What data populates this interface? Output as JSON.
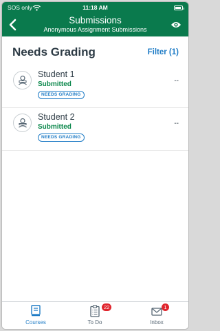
{
  "status_bar": {
    "carrier": "SOS only",
    "time": "11:18 AM"
  },
  "nav": {
    "title": "Submissions",
    "subtitle": "Anonymous Assignment Submissions"
  },
  "header": {
    "title": "Needs Grading",
    "filter_label": "Filter (1)"
  },
  "students": [
    {
      "name": "Student 1",
      "status": "Submitted",
      "badge": "NEEDS GRADING",
      "grade": "--"
    },
    {
      "name": "Student 2",
      "status": "Submitted",
      "badge": "NEEDS GRADING",
      "grade": "--"
    }
  ],
  "tabs": [
    {
      "label": "Courses",
      "icon": "book-icon",
      "active": true
    },
    {
      "label": "To Do",
      "icon": "clipboard-icon",
      "badge": "22"
    },
    {
      "label": "Inbox",
      "icon": "envelope-icon",
      "badge": "1"
    }
  ],
  "colors": {
    "nav": "#0a7a4d",
    "accent": "#1f7cc6",
    "submitted": "#0b874b",
    "badge": "#e0252d"
  }
}
